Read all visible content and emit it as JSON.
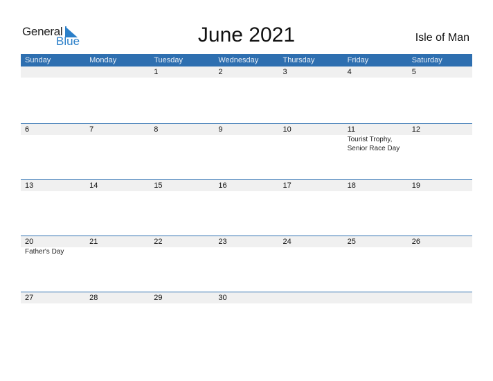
{
  "logo": {
    "general": "General",
    "blue": "Blue"
  },
  "title": "June 2021",
  "country": "Isle of Man",
  "colors": {
    "accent": "#2e6fb0",
    "logo_blue": "#2a7fc9",
    "row_bg": "#f0f0f0"
  },
  "weekdays": [
    "Sunday",
    "Monday",
    "Tuesday",
    "Wednesday",
    "Thursday",
    "Friday",
    "Saturday"
  ],
  "weeks": [
    {
      "days": [
        "",
        "",
        "1",
        "2",
        "3",
        "4",
        "5"
      ],
      "events": [
        "",
        "",
        "",
        "",
        "",
        "",
        ""
      ]
    },
    {
      "days": [
        "6",
        "7",
        "8",
        "9",
        "10",
        "11",
        "12"
      ],
      "events": [
        "",
        "",
        "",
        "",
        "",
        "Tourist Trophy,\nSenior Race Day",
        ""
      ]
    },
    {
      "days": [
        "13",
        "14",
        "15",
        "16",
        "17",
        "18",
        "19"
      ],
      "events": [
        "",
        "",
        "",
        "",
        "",
        "",
        ""
      ]
    },
    {
      "days": [
        "20",
        "21",
        "22",
        "23",
        "24",
        "25",
        "26"
      ],
      "events": [
        "Father's Day",
        "",
        "",
        "",
        "",
        "",
        ""
      ]
    },
    {
      "days": [
        "27",
        "28",
        "29",
        "30",
        "",
        "",
        ""
      ],
      "events": [
        "",
        "",
        "",
        "",
        "",
        "",
        ""
      ]
    }
  ]
}
